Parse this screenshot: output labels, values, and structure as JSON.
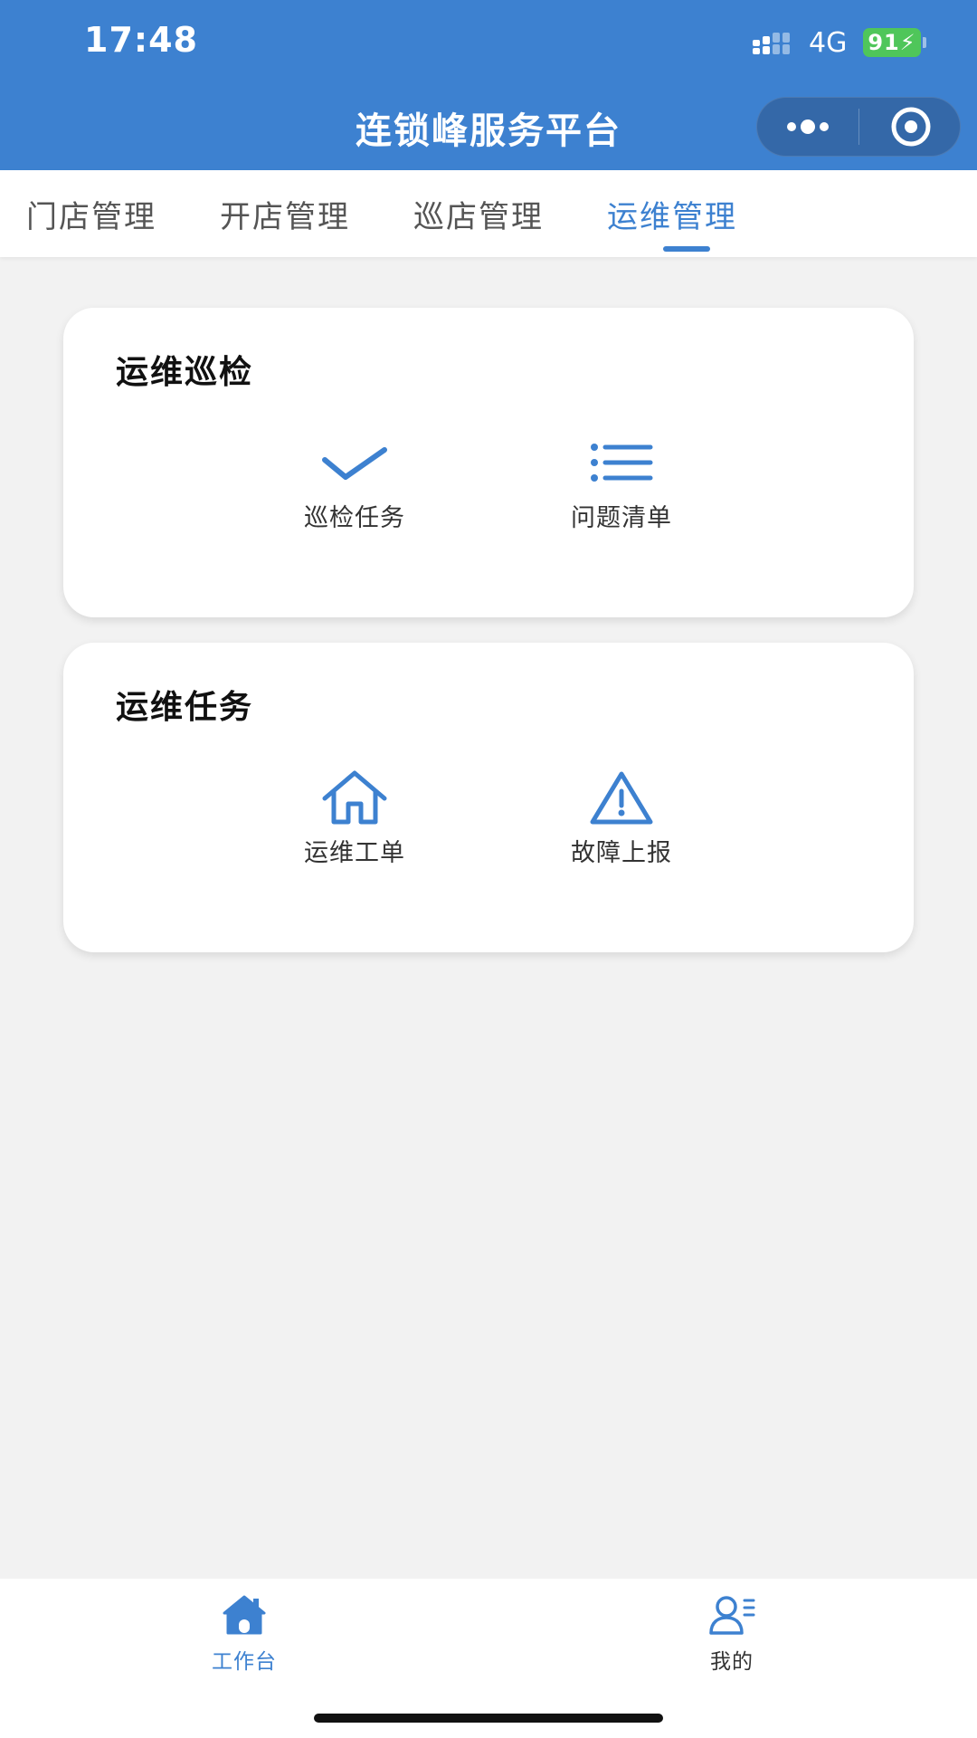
{
  "status_bar": {
    "time": "17:48",
    "network": "4G",
    "battery": "91"
  },
  "header": {
    "title": "连锁峰服务平台"
  },
  "tabs": [
    {
      "label": "门店管理",
      "active": false
    },
    {
      "label": "开店管理",
      "active": false
    },
    {
      "label": "巡店管理",
      "active": false
    },
    {
      "label": "运维管理",
      "active": true
    }
  ],
  "sections": [
    {
      "title": "运维巡检",
      "items": [
        {
          "label": "巡检任务",
          "icon": "checkmark-icon"
        },
        {
          "label": "问题清单",
          "icon": "list-icon"
        }
      ]
    },
    {
      "title": "运维任务",
      "items": [
        {
          "label": "运维工单",
          "icon": "house-icon"
        },
        {
          "label": "故障上报",
          "icon": "warning-icon"
        }
      ]
    }
  ],
  "bottom_nav": [
    {
      "label": "工作台",
      "icon": "house-icon",
      "active": true
    },
    {
      "label": "我的",
      "icon": "user-list-icon",
      "active": false
    }
  ],
  "colors": {
    "primary": "#3d81d0",
    "background": "#f2f2f2",
    "battery": "#4fc65a"
  }
}
